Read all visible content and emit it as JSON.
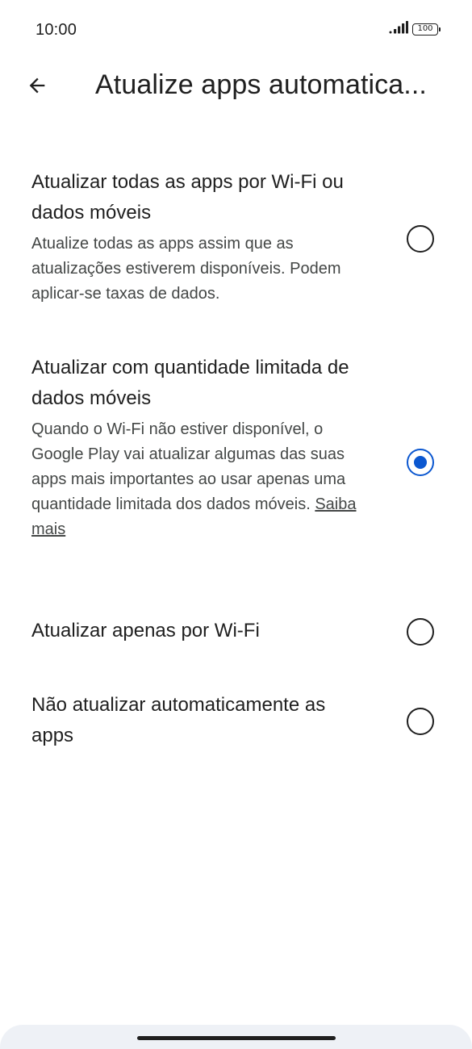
{
  "status_bar": {
    "time": "10:00",
    "battery": "100",
    "signal_icon": "signal-bars-icon",
    "battery_icon": "battery-icon"
  },
  "app_bar": {
    "back_icon": "arrow-left-icon",
    "title": "Atualize apps automatica..."
  },
  "options": [
    {
      "title": "Atualizar todas as apps por Wi-Fi ou dados móveis",
      "description": "Atualize todas as apps assim que as atualizações estiverem disponíveis. Podem aplicar-se taxas de dados.",
      "selected": false
    },
    {
      "title": "Atualizar com quantidade limitada de dados móveis",
      "description": "Quando o Wi-Fi não estiver disponível, o Google Play vai atualizar algumas das suas apps mais importantes ao usar apenas uma quantidade limitada dos dados móveis.",
      "link": "Saiba mais",
      "selected": true
    },
    {
      "title": "Atualizar apenas por Wi-Fi",
      "selected": false
    },
    {
      "title": "Não atualizar automaticamente as apps",
      "selected": false
    }
  ],
  "colors": {
    "accent": "#0b57d0",
    "text_primary": "#1f1f1f",
    "text_secondary": "#444746",
    "nav_background": "#eef1f6"
  }
}
